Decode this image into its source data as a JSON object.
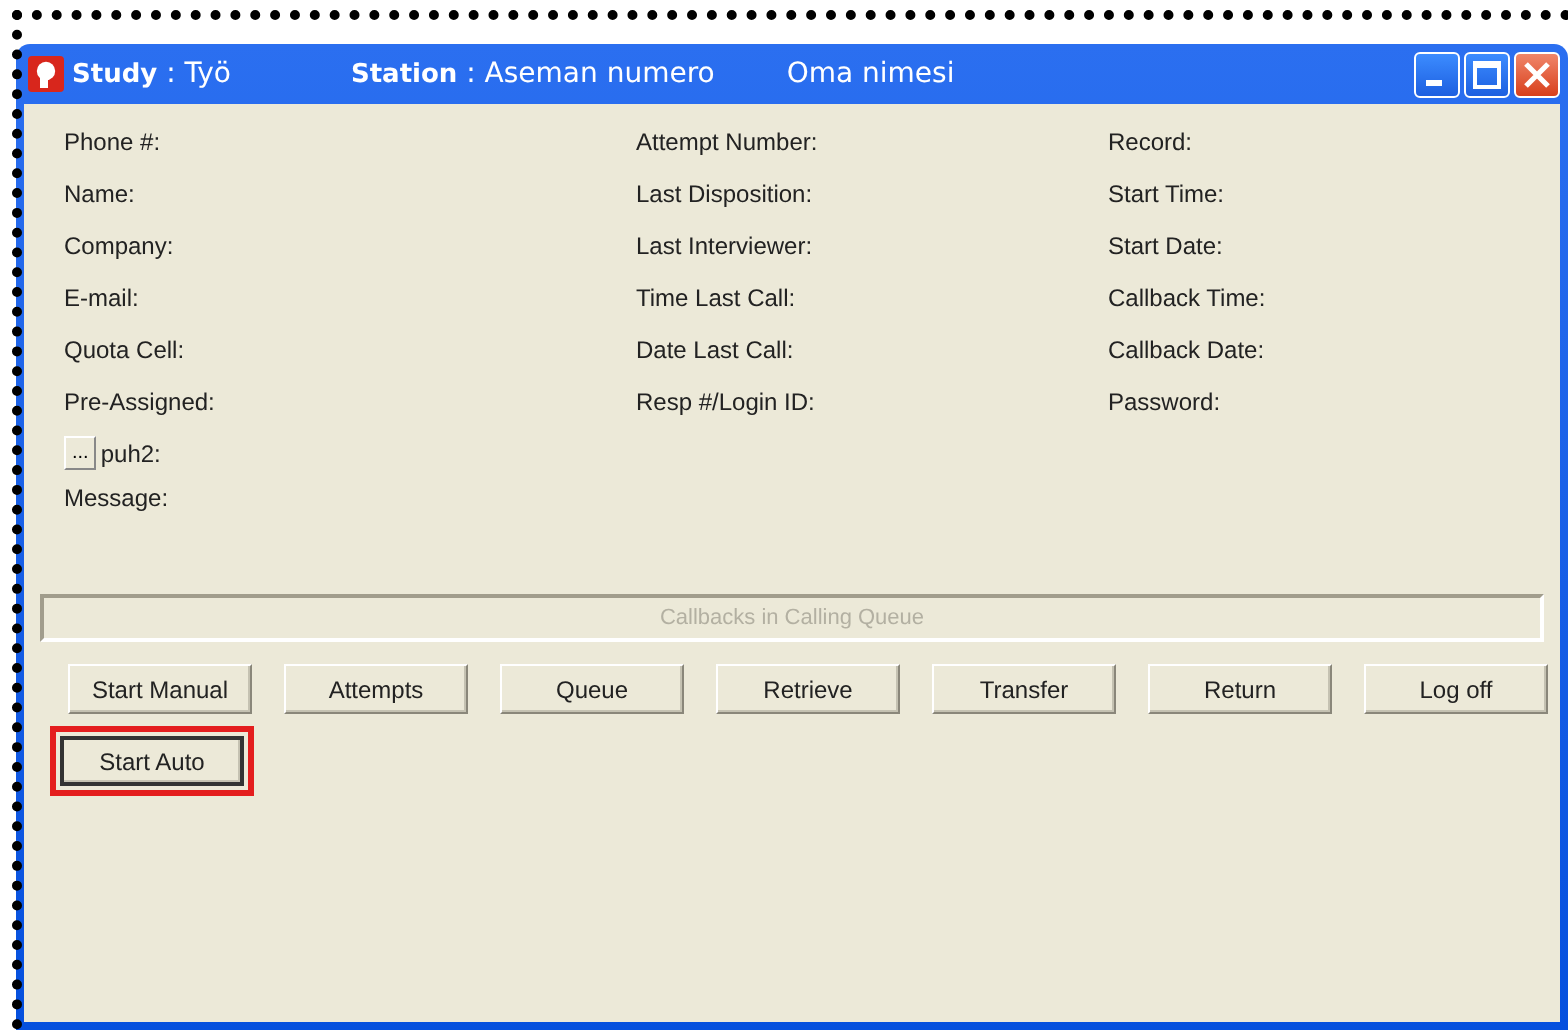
{
  "window": {
    "title_parts": [
      "**Study** : Työ",
      "**Station** : Aseman numero"
    ],
    "user": "Oma nimesi"
  },
  "columns": [
    {
      "fields": [
        {
          "kind": "label",
          "label": "Phone #:"
        },
        {
          "kind": "label",
          "label": "Name:"
        },
        {
          "kind": "label",
          "label": "Company:"
        },
        {
          "kind": "label",
          "label": "E-mail:"
        },
        {
          "kind": "label",
          "label": "Quota Cell:"
        },
        {
          "kind": "label",
          "label": "Pre-Assigned:"
        },
        {
          "kind": "lookup",
          "button": "...",
          "label": "puh2:"
        },
        {
          "kind": "label",
          "label": "Message:"
        }
      ]
    },
    {
      "fields": [
        {
          "kind": "label",
          "label": "Attempt Number:"
        },
        {
          "kind": "label",
          "label": "Last Disposition:"
        },
        {
          "kind": "label",
          "label": "Last Interviewer:"
        },
        {
          "kind": "label",
          "label": "Time Last Call:"
        },
        {
          "kind": "label",
          "label": "Date Last Call:"
        },
        {
          "kind": "label",
          "label": "Resp #/Login ID:"
        }
      ]
    },
    {
      "fields": [
        {
          "kind": "label",
          "label": "Record:"
        },
        {
          "kind": "label",
          "label": "Start Time:"
        },
        {
          "kind": "label",
          "label": "Start Date:"
        },
        {
          "kind": "label",
          "label": "Callback Time:"
        },
        {
          "kind": "label",
          "label": "Callback Date:"
        },
        {
          "kind": "label",
          "label": "Password:"
        }
      ]
    }
  ],
  "callbacks_bar": {
    "label": "Callbacks in Calling Queue"
  },
  "buttons": [
    {
      "label": "Start Manual",
      "focused": false,
      "highlighted": false
    },
    {
      "label": "Attempts",
      "focused": false,
      "highlighted": false
    },
    {
      "label": "Queue",
      "focused": false,
      "highlighted": false
    },
    {
      "label": "Retrieve",
      "focused": false,
      "highlighted": false
    },
    {
      "label": "Transfer",
      "focused": false,
      "highlighted": false
    },
    {
      "label": "Return",
      "focused": false,
      "highlighted": false
    },
    {
      "label": "Log off",
      "focused": false,
      "highlighted": false
    }
  ],
  "extra_buttons": [
    {
      "label": "Start Auto",
      "focused": true,
      "highlighted": true
    }
  ]
}
